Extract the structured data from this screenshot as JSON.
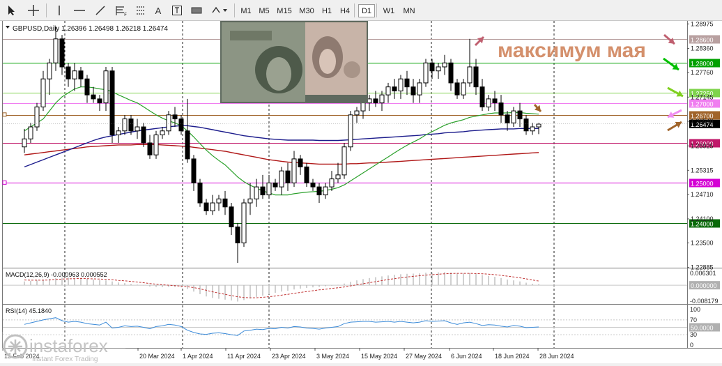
{
  "toolbar": {
    "tools": [
      "cursor-icon",
      "crosshair-icon",
      "vertical-line-icon",
      "horizontal-line-icon",
      "trendline-icon",
      "fibonacci-icon",
      "channels-icon",
      "text-icon",
      "text-label-icon",
      "rectangle-icon",
      "shapes-dropdown-icon"
    ],
    "text_tool_label": "A",
    "fib_tool_label": "F",
    "timeframes": [
      "M1",
      "M5",
      "M15",
      "M30",
      "H1",
      "H4",
      "D1",
      "W1",
      "MN"
    ],
    "active_timeframe": "D1"
  },
  "main_chart": {
    "symbol_header": "GBPUSD,Daily  1.26396 1.26498 1.26218 1.26474",
    "annotation": "максимум мая",
    "price_axis_ticks": [
      "1.28975",
      "1.28360",
      "1.27760",
      "1.27145",
      "1.26540",
      "1.25925",
      "1.25315",
      "1.24710",
      "1.24100",
      "1.23500",
      "1.22885"
    ],
    "current_price": "1.26474",
    "levels": [
      {
        "price": 1.286,
        "label": "1.28600",
        "color": "#b8a0a0"
      },
      {
        "price": 1.28,
        "label": "1.28000",
        "color": "#00a000"
      },
      {
        "price": 1.2725,
        "label": "1.27250",
        "color": "#7fd34c"
      },
      {
        "price": 1.27,
        "label": "1.27000",
        "color": "#f07ef0"
      },
      {
        "price": 1.267,
        "label": "1.26700",
        "color": "#a0642a"
      },
      {
        "price": 1.26,
        "label": "1.26000",
        "color": "#c0186a"
      },
      {
        "price": 1.25,
        "label": "1.25000",
        "color": "#d400d4"
      },
      {
        "price": 1.24,
        "label": "1.24000",
        "color": "#0a6a0a"
      }
    ],
    "arrows": [
      {
        "color": "#c06070",
        "target": "1.28600"
      },
      {
        "color": "#00c000",
        "target": "1.28000"
      },
      {
        "color": "#80d020",
        "target": "1.27250"
      },
      {
        "color": "#f08ef0",
        "target": "1.27000"
      },
      {
        "color": "#a0642a",
        "target": "1.26700"
      },
      {
        "color": "#c06070",
        "target": "may-high"
      },
      {
        "color": "#a0642a",
        "target": "last-candle"
      }
    ]
  },
  "x_axis_labels": [
    "15 Feb 2024",
    "20 Mar 2024",
    "1 Apr 2024",
    "11 Apr 2024",
    "23 Apr 2024",
    "3 May 2024",
    "15 May 2024",
    "27 May 2024",
    "6 Jun 2024",
    "18 Jun 2024",
    "28 Jun 2024"
  ],
  "macd_panel": {
    "label": "MACD(12,26,9) -0.000963 0.000552",
    "ticks": [
      "0.006301",
      "0.000000",
      "-0.008179"
    ],
    "current_value": "0.000000"
  },
  "rsi_panel": {
    "label": "RSI(14) 45.1840",
    "ticks": [
      "100",
      "70",
      "30",
      "0"
    ],
    "current_value": "50.0000"
  },
  "watermark": {
    "brand": "instaforex",
    "tagline": "Instant Forex Trading"
  },
  "chart_data": {
    "type": "candlestick",
    "symbol": "GBPUSD",
    "timeframe": "Daily",
    "ohlc_last": {
      "open": 1.26396,
      "high": 1.26498,
      "low": 1.26218,
      "close": 1.26474
    },
    "ylim": [
      1.2288,
      1.2898
    ],
    "dates": [
      "2024-03-05",
      "2024-03-06",
      "2024-03-07",
      "2024-03-08",
      "2024-03-11",
      "2024-03-12",
      "2024-03-13",
      "2024-03-14",
      "2024-03-15",
      "2024-03-18",
      "2024-03-19",
      "2024-03-20",
      "2024-03-21",
      "2024-03-22",
      "2024-03-25",
      "2024-03-26",
      "2024-03-27",
      "2024-03-28",
      "2024-03-29",
      "2024-04-01",
      "2024-04-02",
      "2024-04-03",
      "2024-04-04",
      "2024-04-05",
      "2024-04-08",
      "2024-04-09",
      "2024-04-10",
      "2024-04-11",
      "2024-04-12",
      "2024-04-15",
      "2024-04-16",
      "2024-04-17",
      "2024-04-18",
      "2024-04-19",
      "2024-04-22",
      "2024-04-23",
      "2024-04-24",
      "2024-04-25",
      "2024-04-26",
      "2024-04-29",
      "2024-04-30",
      "2024-05-01",
      "2024-05-02",
      "2024-05-03",
      "2024-05-06",
      "2024-05-07",
      "2024-05-08",
      "2024-05-09",
      "2024-05-10",
      "2024-05-13",
      "2024-05-14",
      "2024-05-15",
      "2024-05-16",
      "2024-05-17",
      "2024-05-20",
      "2024-05-21",
      "2024-05-22",
      "2024-05-23",
      "2024-05-24",
      "2024-05-27",
      "2024-05-28",
      "2024-05-29",
      "2024-05-30",
      "2024-05-31",
      "2024-06-03",
      "2024-06-04",
      "2024-06-05",
      "2024-06-06",
      "2024-06-07",
      "2024-06-10",
      "2024-06-11",
      "2024-06-12",
      "2024-06-13",
      "2024-06-14",
      "2024-06-17",
      "2024-06-18",
      "2024-06-19",
      "2024-06-20",
      "2024-06-21",
      "2024-06-24",
      "2024-06-25",
      "2024-06-26",
      "2024-06-27"
    ],
    "candles": [
      [
        1.259,
        1.2635,
        1.2575,
        1.261
      ],
      [
        1.261,
        1.265,
        1.26,
        1.264
      ],
      [
        1.264,
        1.27,
        1.263,
        1.269
      ],
      [
        1.269,
        1.278,
        1.268,
        1.276
      ],
      [
        1.276,
        1.281,
        1.272,
        1.28
      ],
      [
        1.28,
        1.289,
        1.278,
        1.286
      ],
      [
        1.286,
        1.287,
        1.277,
        1.279
      ],
      [
        1.279,
        1.28,
        1.274,
        1.276
      ],
      [
        1.276,
        1.28,
        1.273,
        1.278
      ],
      [
        1.278,
        1.279,
        1.274,
        1.276
      ],
      [
        1.276,
        1.277,
        1.27,
        1.272
      ],
      [
        1.272,
        1.274,
        1.27,
        1.271
      ],
      [
        1.271,
        1.272,
        1.268,
        1.27
      ],
      [
        1.27,
        1.279,
        1.268,
        1.278
      ],
      [
        1.278,
        1.279,
        1.26,
        1.262
      ],
      [
        1.262,
        1.264,
        1.26,
        1.263
      ],
      [
        1.263,
        1.267,
        1.262,
        1.266
      ],
      [
        1.266,
        1.267,
        1.262,
        1.263
      ],
      [
        1.263,
        1.266,
        1.261,
        1.264
      ],
      [
        1.264,
        1.265,
        1.259,
        1.26
      ],
      [
        1.26,
        1.262,
        1.256,
        1.257
      ],
      [
        1.257,
        1.263,
        1.256,
        1.262
      ],
      [
        1.262,
        1.264,
        1.261,
        1.263
      ],
      [
        1.263,
        1.268,
        1.262,
        1.267
      ],
      [
        1.267,
        1.269,
        1.264,
        1.266
      ],
      [
        1.266,
        1.267,
        1.262,
        1.263
      ],
      [
        1.263,
        1.271,
        1.255,
        1.256
      ],
      [
        1.256,
        1.257,
        1.248,
        1.25
      ],
      [
        1.25,
        1.251,
        1.244,
        1.245
      ],
      [
        1.245,
        1.246,
        1.242,
        1.243
      ],
      [
        1.243,
        1.247,
        1.242,
        1.245
      ],
      [
        1.245,
        1.247,
        1.243,
        1.246
      ],
      [
        1.246,
        1.248,
        1.242,
        1.244
      ],
      [
        1.244,
        1.245,
        1.237,
        1.239
      ],
      [
        1.239,
        1.24,
        1.23,
        1.235
      ],
      [
        1.235,
        1.246,
        1.234,
        1.245
      ],
      [
        1.245,
        1.25,
        1.242,
        1.246
      ],
      [
        1.246,
        1.251,
        1.244,
        1.249
      ],
      [
        1.249,
        1.252,
        1.246,
        1.247
      ],
      [
        1.247,
        1.252,
        1.246,
        1.25
      ],
      [
        1.25,
        1.251,
        1.248,
        1.249
      ],
      [
        1.249,
        1.254,
        1.247,
        1.253
      ],
      [
        1.253,
        1.255,
        1.248,
        1.25
      ],
      [
        1.25,
        1.258,
        1.249,
        1.256
      ],
      [
        1.256,
        1.257,
        1.252,
        1.254
      ],
      [
        1.254,
        1.255,
        1.249,
        1.25
      ],
      [
        1.25,
        1.251,
        1.248,
        1.249
      ],
      [
        1.249,
        1.25,
        1.245,
        1.247
      ],
      [
        1.247,
        1.25,
        1.246,
        1.249
      ],
      [
        1.249,
        1.253,
        1.248,
        1.251
      ],
      [
        1.251,
        1.255,
        1.25,
        1.252
      ],
      [
        1.252,
        1.26,
        1.251,
        1.259
      ],
      [
        1.259,
        1.268,
        1.258,
        1.267
      ],
      [
        1.267,
        1.269,
        1.265,
        1.268
      ],
      [
        1.268,
        1.271,
        1.266,
        1.27
      ],
      [
        1.27,
        1.272,
        1.268,
        1.271
      ],
      [
        1.271,
        1.273,
        1.269,
        1.27
      ],
      [
        1.27,
        1.273,
        1.268,
        1.272
      ],
      [
        1.272,
        1.275,
        1.27,
        1.274
      ],
      [
        1.274,
        1.276,
        1.271,
        1.273
      ],
      [
        1.273,
        1.277,
        1.271,
        1.276
      ],
      [
        1.276,
        1.278,
        1.272,
        1.274
      ],
      [
        1.274,
        1.276,
        1.27,
        1.272
      ],
      [
        1.272,
        1.276,
        1.27,
        1.275
      ],
      [
        1.275,
        1.281,
        1.274,
        1.28
      ],
      [
        1.28,
        1.281,
        1.276,
        1.278
      ],
      [
        1.278,
        1.28,
        1.276,
        1.279
      ],
      [
        1.279,
        1.282,
        1.277,
        1.28
      ],
      [
        1.28,
        1.281,
        1.273,
        1.275
      ],
      [
        1.275,
        1.276,
        1.271,
        1.272
      ],
      [
        1.272,
        1.276,
        1.271,
        1.275
      ],
      [
        1.275,
        1.286,
        1.274,
        1.279
      ],
      [
        1.279,
        1.281,
        1.272,
        1.274
      ],
      [
        1.274,
        1.276,
        1.268,
        1.269
      ],
      [
        1.269,
        1.272,
        1.268,
        1.271
      ],
      [
        1.271,
        1.273,
        1.268,
        1.27
      ],
      [
        1.27,
        1.272,
        1.265,
        1.267
      ],
      [
        1.267,
        1.268,
        1.263,
        1.265
      ],
      [
        1.265,
        1.269,
        1.264,
        1.268
      ],
      [
        1.268,
        1.27,
        1.264,
        1.266
      ],
      [
        1.266,
        1.267,
        1.262,
        1.263
      ],
      [
        1.263,
        1.265,
        1.262,
        1.264
      ],
      [
        1.264,
        1.265,
        1.2622,
        1.2647
      ]
    ],
    "ma_fast": [
      1.263,
      1.264,
      1.265,
      1.266,
      1.268,
      1.27,
      1.2715,
      1.2725,
      1.2735,
      1.274,
      1.274,
      1.2738,
      1.2735,
      1.2733,
      1.2728,
      1.272,
      1.2713,
      1.2706,
      1.27,
      1.269,
      1.268,
      1.267,
      1.2662,
      1.2655,
      1.265,
      1.2643,
      1.263,
      1.2615,
      1.2598,
      1.2582,
      1.2568,
      1.2556,
      1.2545,
      1.253,
      1.2515,
      1.2503,
      1.2494,
      1.2487,
      1.248,
      1.2475,
      1.247,
      1.247,
      1.247,
      1.2473,
      1.2475,
      1.2477,
      1.2478,
      1.2479,
      1.2481,
      1.2484,
      1.2488,
      1.2495,
      1.2505,
      1.2515,
      1.2525,
      1.2535,
      1.2545,
      1.2555,
      1.2565,
      1.2575,
      1.2585,
      1.2594,
      1.2602,
      1.261,
      1.262,
      1.2628,
      1.2636,
      1.2644,
      1.265,
      1.2654,
      1.2658,
      1.2664,
      1.2667,
      1.267,
      1.2673,
      1.2675,
      1.2675,
      1.2675,
      1.2676,
      1.2676,
      1.2674,
      1.2673,
      1.2672
    ],
    "ma_mid": [
      1.254,
      1.2546,
      1.2552,
      1.2558,
      1.2564,
      1.257,
      1.2576,
      1.2582,
      1.2588,
      1.2594,
      1.26,
      1.2606,
      1.2611,
      1.2615,
      1.2618,
      1.2621,
      1.2624,
      1.2627,
      1.263,
      1.2632,
      1.2634,
      1.2636,
      1.2638,
      1.264,
      1.2642,
      1.2643,
      1.2643,
      1.2641,
      1.2639,
      1.2636,
      1.2633,
      1.263,
      1.2627,
      1.2624,
      1.2621,
      1.2618,
      1.2616,
      1.2614,
      1.2612,
      1.261,
      1.2609,
      1.2608,
      1.2607,
      1.2607,
      1.2607,
      1.2607,
      1.2607,
      1.2606,
      1.2606,
      1.2606,
      1.2606,
      1.2607,
      1.2608,
      1.2609,
      1.261,
      1.2611,
      1.2612,
      1.2613,
      1.2614,
      1.2615,
      1.2616,
      1.2617,
      1.2618,
      1.2619,
      1.2621,
      1.2622,
      1.2623,
      1.2625,
      1.2626,
      1.2627,
      1.2628,
      1.263,
      1.2631,
      1.2632,
      1.2633,
      1.2634,
      1.2635,
      1.2635,
      1.2635,
      1.2636,
      1.2636,
      1.2636,
      1.2636
    ],
    "ma_slow": [
      1.257,
      1.2572,
      1.2574,
      1.2576,
      1.2578,
      1.258,
      1.2582,
      1.2584,
      1.2586,
      1.2588,
      1.259,
      1.2591,
      1.2592,
      1.2593,
      1.2594,
      1.2595,
      1.2595,
      1.2595,
      1.2596,
      1.2596,
      1.2596,
      1.2596,
      1.2595,
      1.2594,
      1.2593,
      1.2592,
      1.2591,
      1.2589,
      1.2587,
      1.2585,
      1.2583,
      1.2581,
      1.2579,
      1.2576,
      1.2573,
      1.257,
      1.2567,
      1.2564,
      1.2561,
      1.2558,
      1.2556,
      1.2554,
      1.2552,
      1.2551,
      1.255,
      1.2549,
      1.2548,
      1.2547,
      1.2547,
      1.2547,
      1.2547,
      1.2547,
      1.2548,
      1.2548,
      1.2549,
      1.255,
      1.255,
      1.2551,
      1.2552,
      1.2553,
      1.2554,
      1.2555,
      1.2556,
      1.2557,
      1.2558,
      1.2559,
      1.256,
      1.2561,
      1.2562,
      1.2563,
      1.2564,
      1.2565,
      1.2566,
      1.2567,
      1.2568,
      1.2569,
      1.257,
      1.2571,
      1.2572,
      1.2573,
      1.2574,
      1.2575,
      1.2576
    ],
    "macd_hist": [
      0.0018,
      0.002,
      0.0023,
      0.0026,
      0.003,
      0.0034,
      0.0036,
      0.0036,
      0.0035,
      0.0033,
      0.003,
      0.0027,
      0.0024,
      0.0023,
      0.0018,
      0.0013,
      0.001,
      0.0006,
      0.0003,
      -0.0001,
      -0.0006,
      -0.0008,
      -0.0009,
      -0.0008,
      -0.0008,
      -0.001,
      -0.0018,
      -0.003,
      -0.0042,
      -0.0053,
      -0.006,
      -0.0064,
      -0.0068,
      -0.0072,
      -0.0077,
      -0.007,
      -0.0063,
      -0.0055,
      -0.0049,
      -0.0042,
      -0.0036,
      -0.003,
      -0.0026,
      -0.002,
      -0.0016,
      -0.0013,
      -0.001,
      -0.0008,
      -0.0005,
      -0.0002,
      0.0002,
      0.0008,
      0.0016,
      0.0023,
      0.0029,
      0.0034,
      0.0038,
      0.0042,
      0.0046,
      0.0049,
      0.0052,
      0.0054,
      0.0055,
      0.0056,
      0.0059,
      0.006,
      0.0061,
      0.0062,
      0.006,
      0.0057,
      0.0055,
      0.0056,
      0.0053,
      0.0048,
      0.0044,
      0.004,
      0.0034,
      0.0027,
      0.0023,
      0.0018,
      0.0012,
      0.0007,
      0.0005
    ],
    "macd_signal": [
      0.0025,
      0.0024,
      0.0024,
      0.0024,
      0.0025,
      0.0027,
      0.0029,
      0.003,
      0.0031,
      0.0032,
      0.0031,
      0.003,
      0.0029,
      0.0028,
      0.0026,
      0.0023,
      0.0021,
      0.0018,
      0.0015,
      0.0012,
      0.0008,
      0.0005,
      0.0002,
      0.0,
      -0.0002,
      -0.0004,
      -0.0007,
      -0.0011,
      -0.0017,
      -0.0024,
      -0.0031,
      -0.0037,
      -0.0043,
      -0.0049,
      -0.0054,
      -0.0058,
      -0.0059,
      -0.0059,
      -0.0057,
      -0.0054,
      -0.0051,
      -0.0047,
      -0.0043,
      -0.0038,
      -0.0034,
      -0.003,
      -0.0026,
      -0.0022,
      -0.0019,
      -0.0015,
      -0.0012,
      -0.0008,
      -0.0003,
      0.0002,
      0.0007,
      0.0012,
      0.0017,
      0.0022,
      0.0027,
      0.0031,
      0.0035,
      0.0039,
      0.0042,
      0.0045,
      0.0048,
      0.005,
      0.0052,
      0.0054,
      0.0055,
      0.0056,
      0.0056,
      0.0056,
      0.0055,
      0.0054,
      0.0052,
      0.005,
      0.0047,
      0.0043,
      0.0039,
      0.0035,
      0.003,
      0.0025,
      0.002
    ],
    "rsi": [
      58,
      62,
      66,
      70,
      73,
      76,
      68,
      64,
      66,
      64,
      60,
      58,
      56,
      64,
      48,
      50,
      54,
      52,
      53,
      50,
      46,
      52,
      54,
      58,
      56,
      52,
      42,
      36,
      32,
      31,
      34,
      35,
      33,
      30,
      28,
      40,
      42,
      45,
      44,
      47,
      46,
      50,
      48,
      52,
      51,
      48,
      47,
      45,
      48,
      50,
      52,
      60,
      64,
      65,
      66,
      66,
      64,
      65,
      66,
      64,
      66,
      64,
      62,
      64,
      68,
      66,
      67,
      68,
      62,
      58,
      62,
      64,
      60,
      55,
      57,
      56,
      53,
      51,
      55,
      53,
      49,
      50,
      51
    ],
    "macd_ylim": [
      -0.008179,
      0.006301
    ],
    "rsi_ylim": [
      0,
      100
    ]
  }
}
